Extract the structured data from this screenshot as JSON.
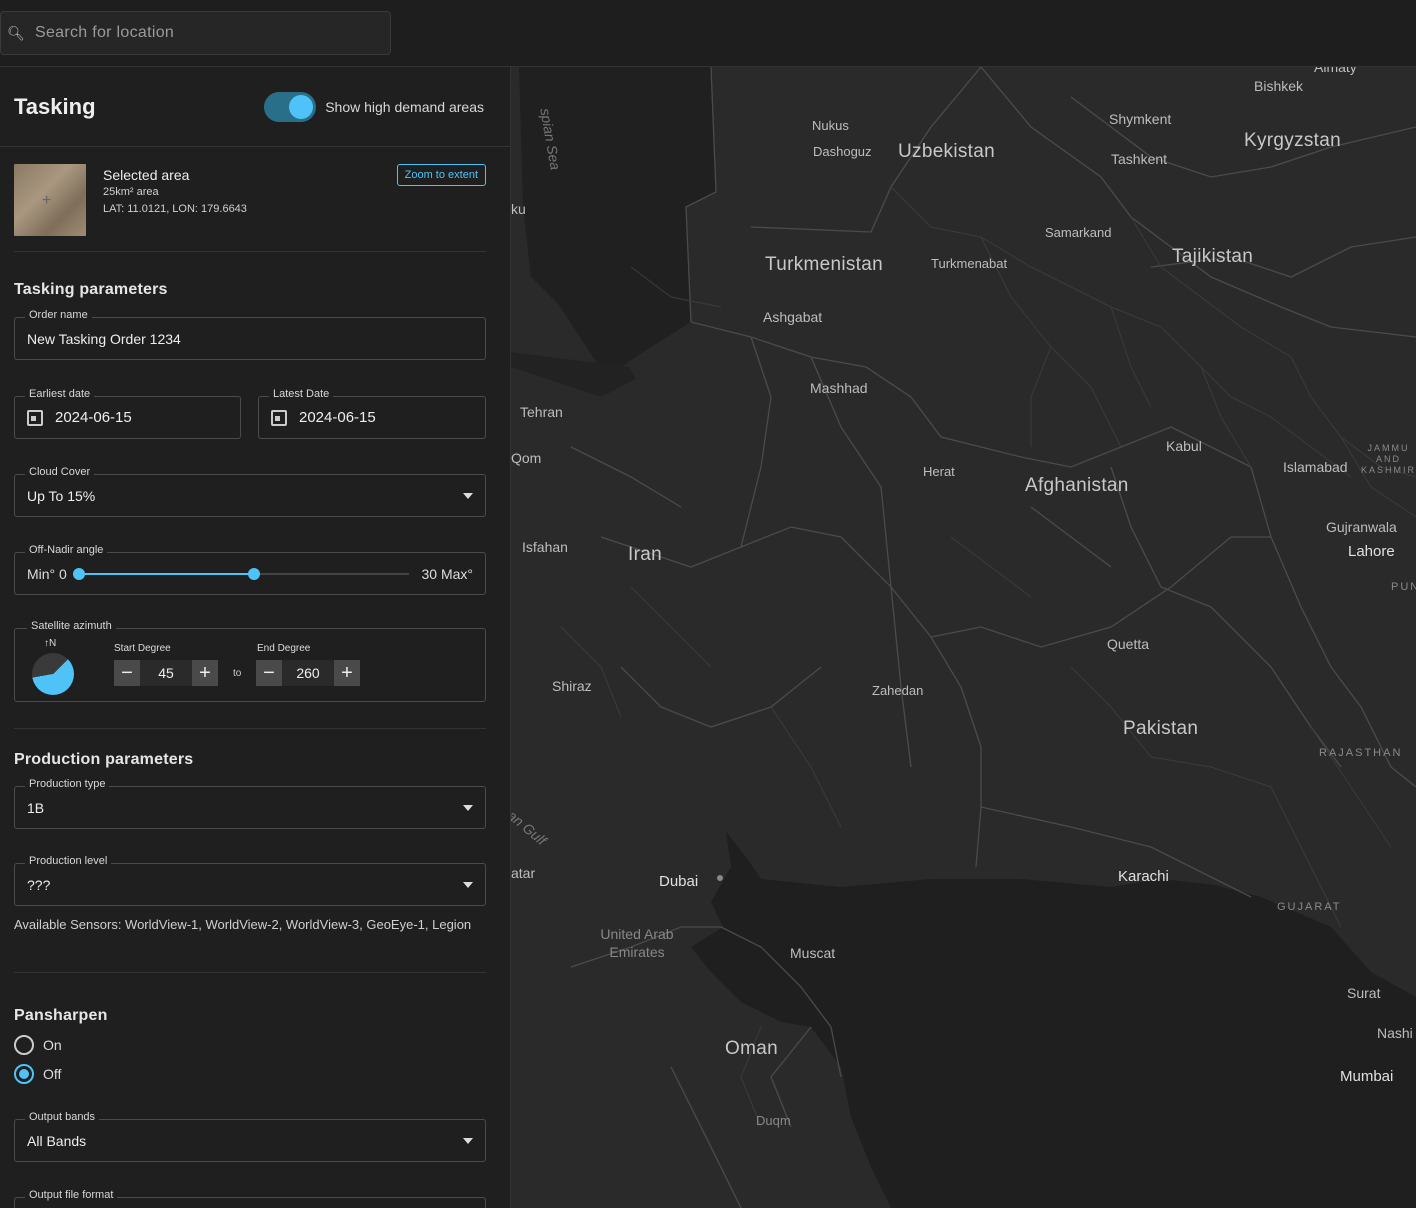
{
  "search": {
    "placeholder": "Search for location",
    "icon": "search-icon"
  },
  "panel": {
    "title": "Tasking",
    "toggle_label": "Show high demand areas",
    "toggle_on": true,
    "selected": {
      "title": "Selected area",
      "area": "25km² area",
      "coords": "LAT: 11.0121, LON: 179.6643",
      "zoom_label": "Zoom to extent"
    },
    "tasking": {
      "title": "Tasking parameters",
      "order_name_label": "Order name",
      "order_name": "New Tasking Order 1234",
      "earliest_label": "Earliest date",
      "earliest_value": "2024-06-15",
      "latest_label": "Latest Date",
      "latest_value": "2024-06-15",
      "cloud_label": "Cloud Cover",
      "cloud_value": "Up To 15%",
      "nadir_label": "Off-Nadir angle",
      "nadir_min": "Min° 0",
      "nadir_max": "30 Max°",
      "nadir_level": 0.53,
      "azimuth_label": "Satellite azimuth",
      "north": "↑N",
      "start_label": "Start Degree",
      "start_value": "45",
      "to_label": "to",
      "end_label": "End Degree",
      "end_value": "260"
    },
    "production": {
      "title": "Production parameters",
      "type_label": "Production type",
      "type_value": "1B",
      "level_label": "Production level",
      "level_value": "???",
      "sensors": "Available Sensors: WorldView-1, WorldView-2, WorldView-3, GeoEye-1, Legion"
    },
    "pansharpen": {
      "title": "Pansharpen",
      "on_label": "On",
      "off_label": "Off",
      "selected": "Off",
      "bands_label": "Output bands",
      "bands_value": "All Bands",
      "format_label": "Output file format"
    }
  },
  "map": {
    "labels": {
      "almaty": "Almaty",
      "bishkek": "Bishkek",
      "nukus": "Nukus",
      "dashoguz": "Dashoguz",
      "uzbekistan": "Uzbekistan",
      "shymkent": "Shymkent",
      "kyrgyzstan": "Kyrgyzstan",
      "tashkent": "Tashkent",
      "samarkand": "Samarkand",
      "turkmenistan": "Turkmenistan",
      "turkmenabat": "Turkmenabat",
      "tajikistan": "Tajikistan",
      "ashgabat": "Ashgabat",
      "mashhad": "Mashhad",
      "tehran": "Tehran",
      "qom": "Qom",
      "kabul": "Kabul",
      "jammu": "JAMMU AND KASHMIR",
      "islamabad": "Islamabad",
      "herat": "Herat",
      "afghanistan": "Afghanistan",
      "isfahan": "Isfahan",
      "iran": "Iran",
      "gujranwala": "Gujranwala",
      "lahore": "Lahore",
      "punjab": "PUN",
      "quetta": "Quetta",
      "shiraz": "Shiraz",
      "zahedan": "Zahedan",
      "pakistan": "Pakistan",
      "rajasthan": "RAJASTHAN",
      "dubai": "Dubai",
      "karachi": "Karachi",
      "gujarat": "GUJARAT",
      "uae": "United Arab Emirates",
      "muscat": "Muscat",
      "surat": "Surat",
      "nashik": "Nashi",
      "oman": "Oman",
      "mumbai": "Mumbai",
      "duqm": "Duqm",
      "caspian": "spian Sea",
      "gulf": "an Gulf",
      "baku": "ku",
      "qatar": "atar"
    }
  }
}
